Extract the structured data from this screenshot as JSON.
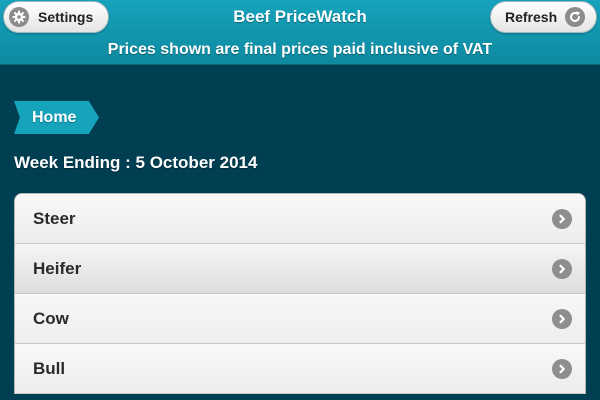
{
  "header": {
    "title": "Beef PriceWatch",
    "subtitle": "Prices shown are final prices paid inclusive of VAT",
    "settings_label": "Settings",
    "refresh_label": "Refresh",
    "settings_icon": "gear-icon",
    "refresh_icon": "refresh-icon"
  },
  "breadcrumb": {
    "home_label": "Home"
  },
  "week": {
    "label": "Week Ending : 5 October 2014"
  },
  "list": {
    "items": [
      {
        "label": "Steer",
        "icon": "chevron-right-icon"
      },
      {
        "label": "Heifer",
        "icon": "chevron-right-icon"
      },
      {
        "label": "Cow",
        "icon": "chevron-right-icon"
      },
      {
        "label": "Bull",
        "icon": "chevron-right-icon"
      }
    ]
  },
  "colors": {
    "background": "#003e52",
    "header": "#16a3bc",
    "list_item": "#f2f2f2",
    "icon_grey": "#8e8e8e"
  }
}
